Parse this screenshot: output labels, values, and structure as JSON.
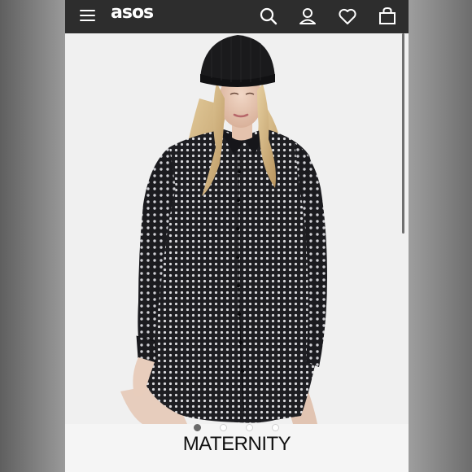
{
  "header": {
    "logo": "asos",
    "icons": [
      "menu-icon",
      "search-icon",
      "account-icon",
      "heart-icon",
      "bag-icon"
    ]
  },
  "product_image": {
    "carousel": {
      "total": 4,
      "active_index": 1
    }
  },
  "caption": "MATERNITY",
  "colors": {
    "header_bg": "#2d2d2d",
    "page_bg": "#f1f1f1",
    "dress_dark": "#1e1e22",
    "dress_dots": "#d9d9dc",
    "beanie": "#1a1a1c",
    "hair": "#d8b98a"
  }
}
